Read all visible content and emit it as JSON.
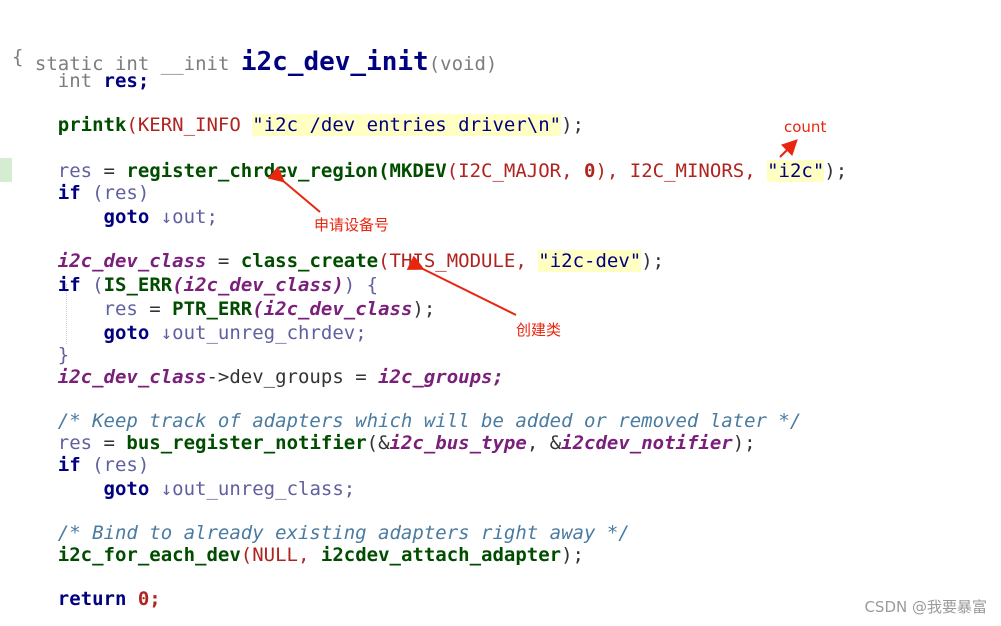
{
  "code": {
    "sig_static": "static",
    "sig_int": "int",
    "sig_init": "__init",
    "sig_fn": "i2c_dev_init",
    "sig_args": "(void)",
    "open_brace": "{",
    "decl_type": "int",
    "decl_var": "res;",
    "printk": "printk",
    "kern_info": "(KERN_INFO",
    "printk_str": "\"i2c /dev entries driver\\n\"",
    "printk_end": ");",
    "res": "res",
    "eq": " = ",
    "reg_fn": "register_chrdev_region",
    "mkdev": "(MKDEV",
    "major": "(I2C_MAJOR,",
    "zero": "0",
    "minors": "), I2C_MINORS,",
    "i2c_str": "\"i2c\"",
    "end_paren_semi": ");",
    "if_kw": "if",
    "if_res": "(res)",
    "goto_kw": "goto",
    "goto_out": "↓out;",
    "class_var": "i2c_dev_class",
    "class_create": "class_create",
    "this_module": "(THIS_MODULE,",
    "dev_str": "\"i2c-dev\"",
    "if_open": "(",
    "is_err": "IS_ERR",
    "class_arg": "(i2c_dev_class)",
    "if_close": ") {",
    "ptr_err": "PTR_ERR",
    "ptr_arg": "(i2c_dev_class",
    "goto_unreg": "↓out_unreg_chrdev;",
    "close_brace": "}",
    "arrow_groups": "->dev_groups = ",
    "groups": "i2c_groups;",
    "comment1": "/* Keep track of adapters which will be added or removed later */",
    "bus_reg": "bus_register_notifier",
    "bus_args_a": "(&",
    "bus_type": "i2c_bus_type",
    "bus_args_b": ", &",
    "notifier": "i2cdev_notifier",
    "goto_unreg_class": "↓out_unreg_class;",
    "comment2": "/* Bind to already existing adapters right away */",
    "for_each": "i2c_for_each_dev",
    "null_arg": "(NULL,",
    "attach": " i2cdev_attach_adapter",
    "return_kw": "return",
    "return_val": "0;"
  },
  "annotations": {
    "count": "count",
    "register_note": "申请设备号",
    "class_note": "创建类"
  },
  "watermark": "CSDN @我要暴富",
  "colors": {
    "annotation": "#e8260e"
  }
}
